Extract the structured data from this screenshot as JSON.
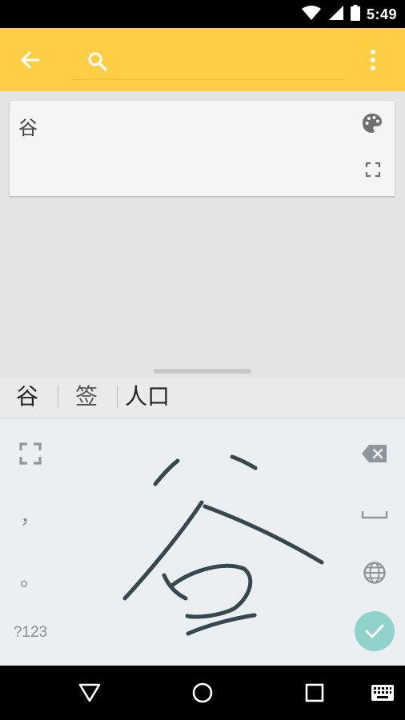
{
  "status_bar": {
    "time": "5:49",
    "icons": [
      "wifi-icon",
      "cell-signal-icon",
      "battery-icon"
    ]
  },
  "app_bar": {
    "color": "#ffce45",
    "search": {
      "value": "",
      "placeholder": ""
    },
    "icons": [
      "back-arrow-icon",
      "search-icon",
      "more-vert-icon"
    ]
  },
  "note": {
    "text": "谷",
    "icons": [
      "palette-icon",
      "expand-icon"
    ]
  },
  "suggestions": [
    {
      "text": "谷"
    },
    {
      "text": "签"
    },
    {
      "text": "人口"
    }
  ],
  "keyboard": {
    "comma": "，",
    "period": "。",
    "symbols_label": "?123",
    "handwritten_glyph": "谷",
    "accent_color": "#8fd3cb",
    "icons": [
      "fullscreen-icon",
      "backspace-icon",
      "space-icon",
      "globe-icon",
      "check-icon"
    ]
  },
  "nav_bar": {
    "icons": [
      "back-triangle-icon",
      "home-circle-icon",
      "recents-square-icon",
      "keyboard-switch-icon"
    ]
  }
}
